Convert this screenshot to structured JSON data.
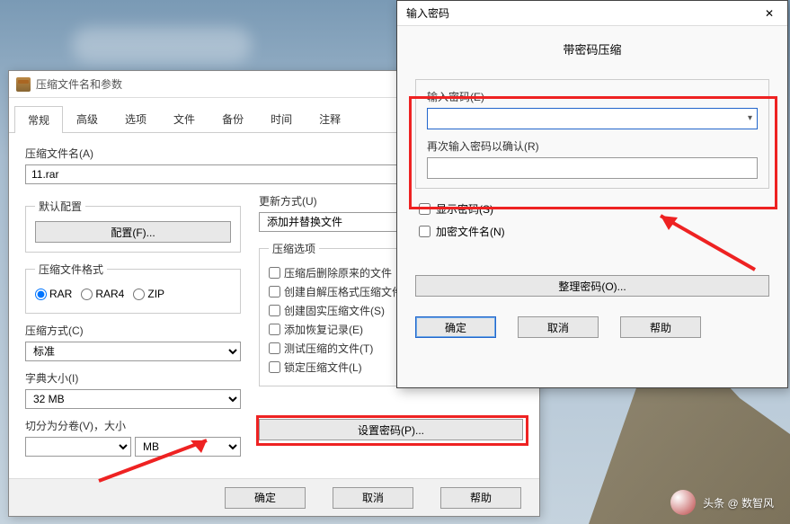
{
  "main_dialog": {
    "title": "压缩文件名和参数",
    "tabs": [
      "常规",
      "高级",
      "选项",
      "文件",
      "备份",
      "时间",
      "注释"
    ],
    "archive_name_label": "压缩文件名(A)",
    "archive_name_value": "11.rar",
    "default_profile_legend": "默认配置",
    "profiles_btn": "配置(F)...",
    "update_mode_label": "更新方式(U)",
    "update_mode_value": "添加并替换文件",
    "format_legend": "压缩文件格式",
    "formats": [
      "RAR",
      "RAR4",
      "ZIP"
    ],
    "method_label": "压缩方式(C)",
    "method_value": "标准",
    "dict_label": "字典大小(I)",
    "dict_value": "32 MB",
    "split_label": "切分为分卷(V)，大小",
    "split_unit": "MB",
    "options_legend": "压缩选项",
    "options": [
      "压缩后删除原来的文件",
      "创建自解压格式压缩文件",
      "创建固实压缩文件(S)",
      "添加恢复记录(E)",
      "测试压缩的文件(T)",
      "锁定压缩文件(L)"
    ],
    "set_password_btn": "设置密码(P)...",
    "ok_btn": "确定",
    "cancel_btn": "取消",
    "help_btn": "帮助"
  },
  "pw_dialog": {
    "title": "输入密码",
    "header": "带密码压缩",
    "enter_label": "输入密码(E)",
    "confirm_label": "再次输入密码以确认(R)",
    "show_pw": "显示密码(S)",
    "encrypt_names": "加密文件名(N)",
    "organize_btn": "整理密码(O)...",
    "ok_btn": "确定",
    "cancel_btn": "取消",
    "help_btn": "帮助"
  },
  "watermark": "头条 @ 数智风"
}
